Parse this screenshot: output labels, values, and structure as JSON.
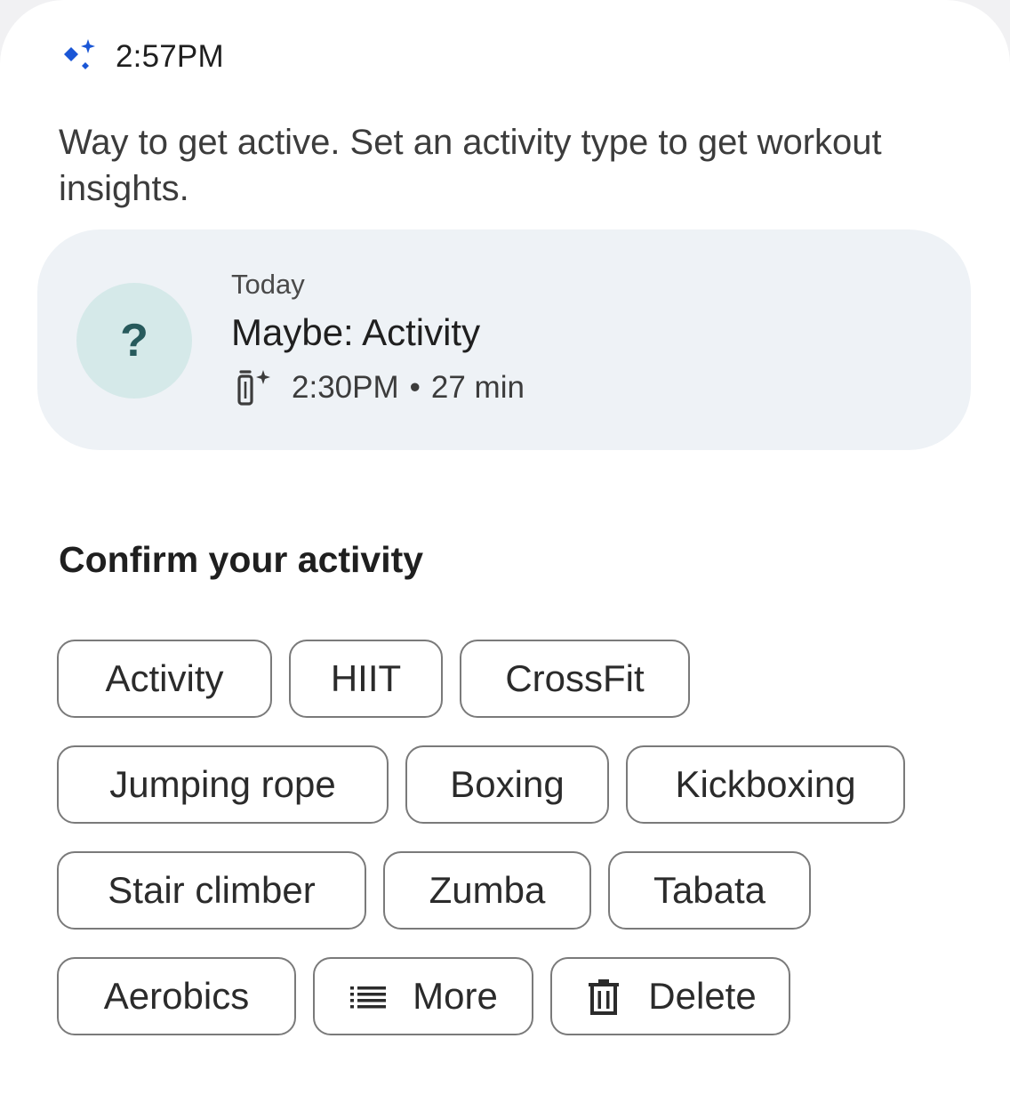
{
  "message": {
    "timestamp": "2:57PM",
    "text": "Way to get active. Set an activity type to get workout insights."
  },
  "card": {
    "day": "Today",
    "title": "Maybe: Activity",
    "start_time": "2:30PM",
    "separator": "•",
    "duration": "27 min",
    "avatar_symbol": "?"
  },
  "confirm": {
    "heading": "Confirm your activity",
    "chips": [
      "Activity",
      "HIIT",
      "CrossFit",
      "Jumping rope",
      "Boxing",
      "Kickboxing",
      "Stair climber",
      "Zumba",
      "Tabata",
      "Aerobics"
    ],
    "more_label": "More",
    "delete_label": "Delete"
  },
  "icons": {
    "sparkle": "sparkle-icon",
    "device": "fitbit-device-icon",
    "more": "list-icon",
    "delete": "trash-icon"
  },
  "colors": {
    "sparkle_blue": "#1a56d6",
    "card_background": "#eef2f6",
    "avatar_background": "#d5e9e9",
    "avatar_text": "#275a5c",
    "chip_border": "#7a7a7a"
  }
}
